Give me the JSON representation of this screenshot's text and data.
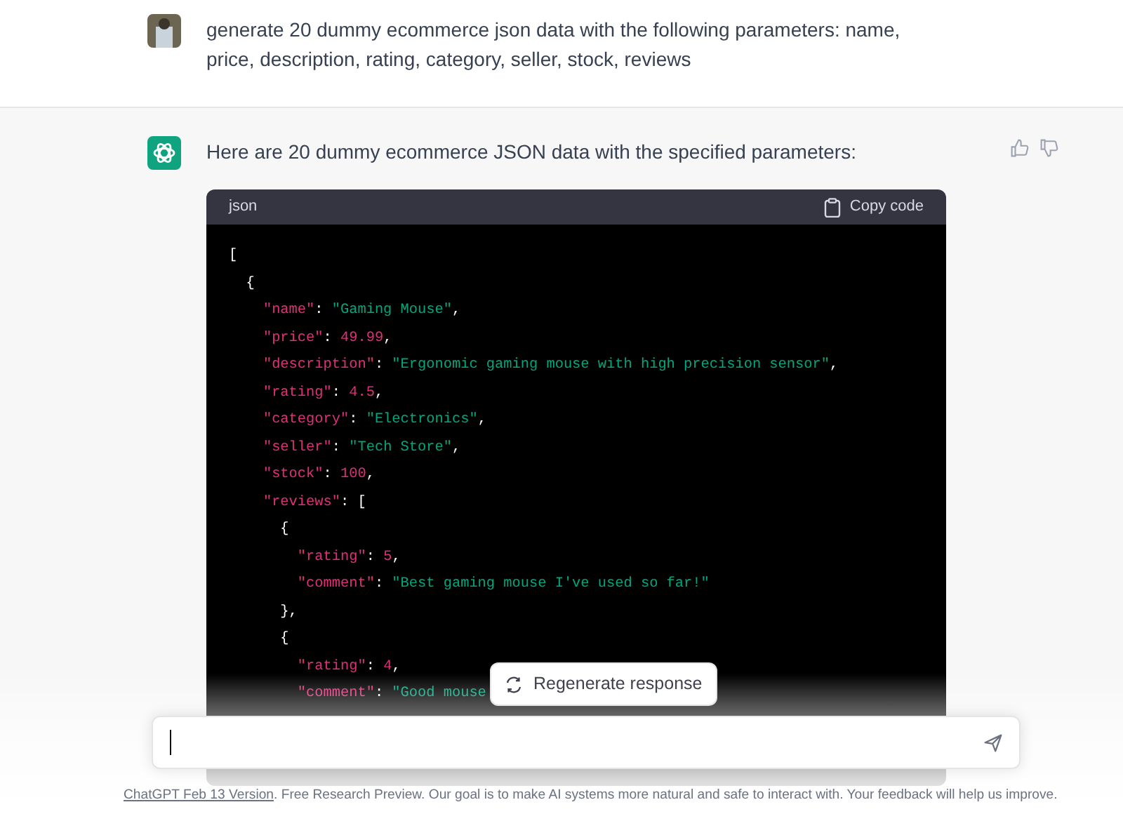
{
  "user_message": {
    "text": "generate 20 dummy ecommerce json data with the following parameters: name, price, description, rating, category, seller, stock, reviews"
  },
  "assistant_message": {
    "intro": "Here are 20 dummy ecommerce JSON data with the specified parameters:",
    "code_block": {
      "language": "json",
      "copy_label": "Copy code",
      "lines": [
        [
          {
            "kind": "punct",
            "text": "["
          }
        ],
        [
          {
            "kind": "punct",
            "text": "  {"
          }
        ],
        [
          {
            "kind": "key",
            "text": "    \"name\""
          },
          {
            "kind": "punct",
            "text": ": "
          },
          {
            "kind": "string",
            "text": "\"Gaming Mouse\""
          },
          {
            "kind": "punct",
            "text": ","
          }
        ],
        [
          {
            "kind": "key",
            "text": "    \"price\""
          },
          {
            "kind": "punct",
            "text": ": "
          },
          {
            "kind": "number",
            "text": "49.99"
          },
          {
            "kind": "punct",
            "text": ","
          }
        ],
        [
          {
            "kind": "key",
            "text": "    \"description\""
          },
          {
            "kind": "punct",
            "text": ": "
          },
          {
            "kind": "string",
            "text": "\"Ergonomic gaming mouse with high precision sensor\""
          },
          {
            "kind": "punct",
            "text": ","
          }
        ],
        [
          {
            "kind": "key",
            "text": "    \"rating\""
          },
          {
            "kind": "punct",
            "text": ": "
          },
          {
            "kind": "number",
            "text": "4.5"
          },
          {
            "kind": "punct",
            "text": ","
          }
        ],
        [
          {
            "kind": "key",
            "text": "    \"category\""
          },
          {
            "kind": "punct",
            "text": ": "
          },
          {
            "kind": "string",
            "text": "\"Electronics\""
          },
          {
            "kind": "punct",
            "text": ","
          }
        ],
        [
          {
            "kind": "key",
            "text": "    \"seller\""
          },
          {
            "kind": "punct",
            "text": ": "
          },
          {
            "kind": "string",
            "text": "\"Tech Store\""
          },
          {
            "kind": "punct",
            "text": ","
          }
        ],
        [
          {
            "kind": "key",
            "text": "    \"stock\""
          },
          {
            "kind": "punct",
            "text": ": "
          },
          {
            "kind": "number",
            "text": "100"
          },
          {
            "kind": "punct",
            "text": ","
          }
        ],
        [
          {
            "kind": "key",
            "text": "    \"reviews\""
          },
          {
            "kind": "punct",
            "text": ": ["
          }
        ],
        [
          {
            "kind": "punct",
            "text": "      {"
          }
        ],
        [
          {
            "kind": "key",
            "text": "        \"rating\""
          },
          {
            "kind": "punct",
            "text": ": "
          },
          {
            "kind": "number",
            "text": "5"
          },
          {
            "kind": "punct",
            "text": ","
          }
        ],
        [
          {
            "kind": "key",
            "text": "        \"comment\""
          },
          {
            "kind": "punct",
            "text": ": "
          },
          {
            "kind": "string",
            "text": "\"Best gaming mouse I've used so far!\""
          }
        ],
        [
          {
            "kind": "punct",
            "text": "      },"
          }
        ],
        [
          {
            "kind": "punct",
            "text": "      {"
          }
        ],
        [
          {
            "kind": "key",
            "text": "        \"rating\""
          },
          {
            "kind": "punct",
            "text": ": "
          },
          {
            "kind": "number",
            "text": "4"
          },
          {
            "kind": "punct",
            "text": ","
          }
        ],
        [
          {
            "kind": "key",
            "text": "        \"comment\""
          },
          {
            "kind": "punct",
            "text": ": "
          },
          {
            "kind": "string",
            "text": "\"Good mouse"
          }
        ]
      ]
    }
  },
  "regenerate_button": {
    "label": "Regenerate response"
  },
  "footer": {
    "link": "ChatGPT Feb 13 Version",
    "text": ". Free Research Preview. Our goal is to make AI systems more natural and safe to interact with. Your feedback will help us improve."
  }
}
